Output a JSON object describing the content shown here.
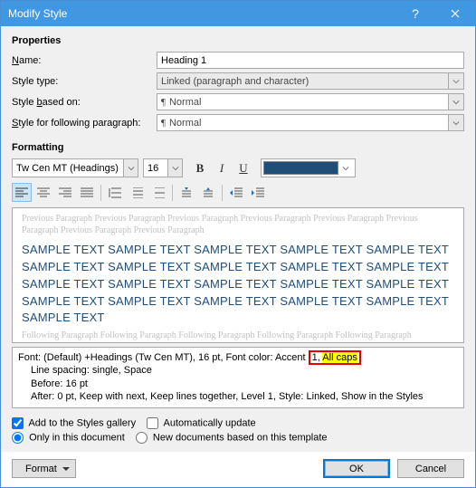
{
  "titlebar": {
    "title": "Modify Style"
  },
  "properties": {
    "heading": "Properties",
    "name_label": "Name:",
    "name_value": "Heading 1",
    "style_type_label": "Style type:",
    "style_type_value": "Linked (paragraph and character)",
    "based_on_label": "Style based on:",
    "based_on_value": "Normal",
    "following_label": "Style for following paragraph:",
    "following_value": "Normal"
  },
  "formatting": {
    "heading": "Formatting",
    "font_name": "Tw Cen MT (Headings)",
    "font_size": "16",
    "bold": "B",
    "italic": "I",
    "underline": "U",
    "color": "#1f4e79"
  },
  "preview": {
    "ghost_before": "Previous Paragraph Previous Paragraph Previous Paragraph Previous Paragraph Previous Paragraph Previous Paragraph Previous Paragraph Previous Paragraph",
    "sample1": "SAMPLE TEXT SAMPLE TEXT SAMPLE TEXT SAMPLE TEXT SAMPLE TEXT",
    "sample2": "SAMPLE TEXT SAMPLE TEXT SAMPLE TEXT SAMPLE TEXT SAMPLE TEXT",
    "sample3": "SAMPLE TEXT SAMPLE TEXT SAMPLE TEXT SAMPLE TEXT SAMPLE TEXT",
    "sample4": "SAMPLE TEXT SAMPLE TEXT SAMPLE TEXT SAMPLE TEXT SAMPLE TEXT",
    "sample5": "SAMPLE TEXT",
    "ghost_after": "Following Paragraph Following Paragraph Following Paragraph Following Paragraph Following Paragraph"
  },
  "description": {
    "line1a": "Font: (Default) +Headings (Tw Cen MT), 16 pt, Font color: Accent ",
    "line1b": "1, ",
    "line1c": "All caps",
    "line2": "Line spacing:  single, Space",
    "line3": "Before:  16 pt",
    "line4": "After:  0 pt, Keep with next, Keep lines together, Level 1, Style: Linked, Show in the Styles"
  },
  "options": {
    "add_gallery": "Add to the Styles gallery",
    "auto_update": "Automatically update",
    "only_doc": "Only in this document",
    "new_docs": "New documents based on this template"
  },
  "buttons": {
    "format": "Format",
    "ok": "OK",
    "cancel": "Cancel"
  }
}
